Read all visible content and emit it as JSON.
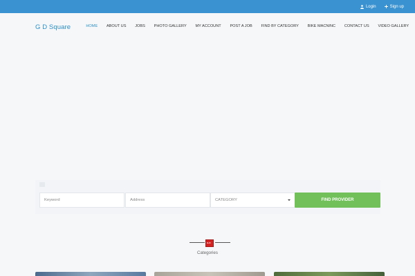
{
  "topbar": {
    "login_label": "Login",
    "signup_label": "Sign up",
    "color": "#3a92d0"
  },
  "header": {
    "logo_text": "G D Square",
    "nav": [
      {
        "label": "HOME",
        "active": true
      },
      {
        "label": "ABOUT US"
      },
      {
        "label": "JOBS"
      },
      {
        "label": "PHOTO GALLERY"
      },
      {
        "label": "MY ACCOUNT"
      },
      {
        "label": "POST A JOB"
      },
      {
        "label": "FIND BY CATEGORY"
      },
      {
        "label": "BIKE MACNINC"
      },
      {
        "label": "CONTACT US"
      },
      {
        "label": "VIDEO GALLERY"
      }
    ]
  },
  "search": {
    "keyword_placeholder": "Keyword",
    "address_placeholder": "Address",
    "category_selected": "CATEGORY",
    "find_button_label": "FIND PROVIDER",
    "button_color": "#72c05a"
  },
  "categories": {
    "title": "Categories"
  }
}
